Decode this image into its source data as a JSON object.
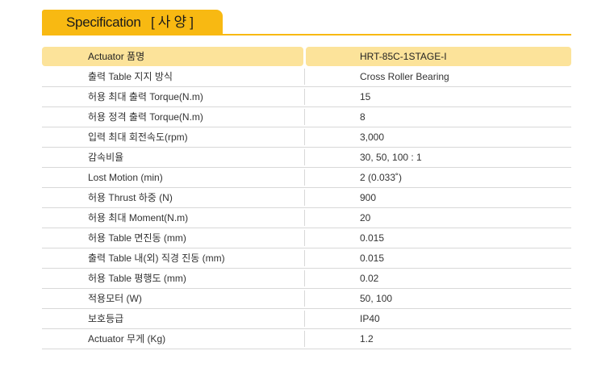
{
  "section": {
    "title": "Specification",
    "title_ko": "[ 사 양 ]"
  },
  "colors": {
    "accent": "#f8b912",
    "header_bg": "#fce39a",
    "row_border": "#d8d8d8"
  },
  "table": {
    "header": {
      "label": "Actuator 품명",
      "value": "HRT-85C-1STAGE-I"
    },
    "rows": [
      {
        "label": "출력 Table 지지 방식",
        "value": "Cross Roller Bearing"
      },
      {
        "label": "허용 최대 출력 Torque(N.m)",
        "value": "15"
      },
      {
        "label": "허용 정격 출력 Torque(N.m)",
        "value": "8"
      },
      {
        "label": "입력 최대 회전속도(rpm)",
        "value": "3,000"
      },
      {
        "label": "감속비율",
        "value": "30, 50, 100 : 1"
      },
      {
        "label": "Lost Motion (min)",
        "value": "2 (0.033˚)"
      },
      {
        "label": "허용 Thrust 하중 (N)",
        "value": "900"
      },
      {
        "label": "허용 최대 Moment(N.m)",
        "value": "20"
      },
      {
        "label": "허용 Table 면진동 (mm)",
        "value": "0.015"
      },
      {
        "label": "출력 Table 내(외) 직경 진동 (mm)",
        "value": "0.015"
      },
      {
        "label": "허용 Table 평행도 (mm)",
        "value": "0.02"
      },
      {
        "label": "적용모터 (W)",
        "value": "50, 100"
      },
      {
        "label": "보호등급",
        "value": "IP40"
      },
      {
        "label": "Actuator 무게 (Kg)",
        "value": "1.2"
      }
    ]
  }
}
